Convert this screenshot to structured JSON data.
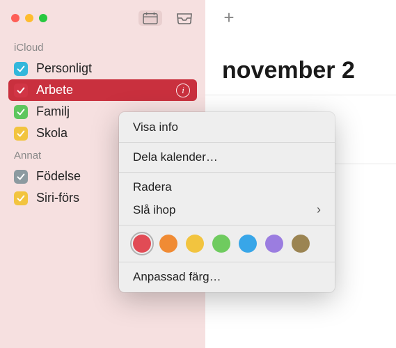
{
  "sidebar": {
    "sections": [
      {
        "title": "iCloud",
        "items": [
          {
            "label": "Personligt",
            "color": "#33b7db",
            "selected": false
          },
          {
            "label": "Arbete",
            "color": "#d13545",
            "selected": true
          },
          {
            "label": "Familj",
            "color": "#5ec65e",
            "selected": false
          },
          {
            "label": "Skola",
            "color": "#f2c43f",
            "selected": false
          }
        ]
      },
      {
        "title": "Annat",
        "items": [
          {
            "label": "Födelse",
            "color": "#8c9aa0",
            "selected": false
          },
          {
            "label": "Siri-förs",
            "color": "#f2c43f",
            "selected": false
          }
        ]
      }
    ]
  },
  "main": {
    "month_title": "november 2"
  },
  "context_menu": {
    "items": {
      "info": "Visa info",
      "share": "Dela kalender…",
      "delete": "Radera",
      "merge": "Slå ihop",
      "custom_color": "Anpassad färg…"
    },
    "colors": [
      {
        "name": "red",
        "hex": "#e14b55",
        "selected": true
      },
      {
        "name": "orange",
        "hex": "#f08b34",
        "selected": false
      },
      {
        "name": "yellow",
        "hex": "#f2c43f",
        "selected": false
      },
      {
        "name": "green",
        "hex": "#6fcb5f",
        "selected": false
      },
      {
        "name": "blue",
        "hex": "#38a6e8",
        "selected": false
      },
      {
        "name": "purple",
        "hex": "#9b7de0",
        "selected": false
      },
      {
        "name": "brown",
        "hex": "#9b8452",
        "selected": false
      }
    ]
  }
}
